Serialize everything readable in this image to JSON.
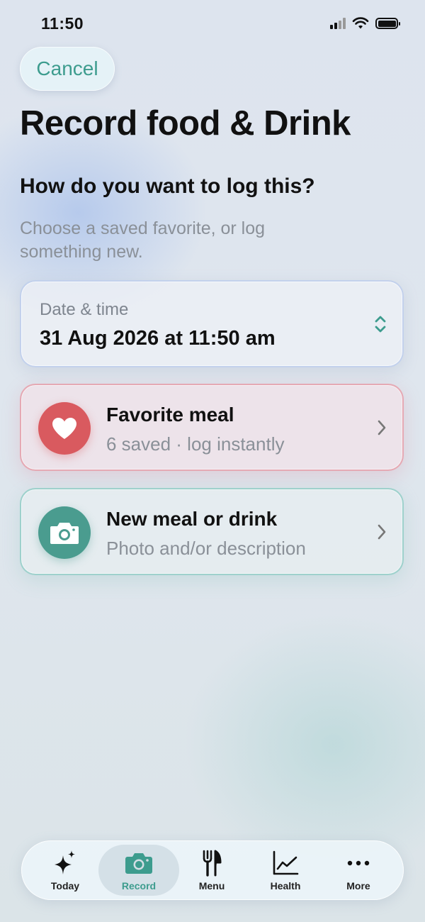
{
  "status_bar": {
    "time": "11:50"
  },
  "header": {
    "cancel_label": "Cancel",
    "title": "Record food & Drink"
  },
  "prompt": {
    "question": "How do you want to log this?",
    "subtitle": "Choose a saved favorite, or log something new."
  },
  "date_time": {
    "label": "Date & time",
    "value": "31 Aug 2026 at 11:50 am"
  },
  "options": [
    {
      "title": "Favorite meal",
      "subtitle": "6 saved · log instantly",
      "icon": "heart-icon",
      "color": "#d95a5f"
    },
    {
      "title": "New meal or drink",
      "subtitle": "Photo and/or description",
      "icon": "camera-icon",
      "color": "#4a9c8f"
    }
  ],
  "tabs": [
    {
      "label": "Today",
      "icon": "sparkle-icon"
    },
    {
      "label": "Record",
      "icon": "camera-icon",
      "active": true
    },
    {
      "label": "Menu",
      "icon": "fork-knife-icon"
    },
    {
      "label": "Health",
      "icon": "chart-line-icon"
    },
    {
      "label": "More",
      "icon": "ellipsis-icon"
    }
  ],
  "colors": {
    "accent": "#3d9c8e",
    "favorite": "#d95a5f"
  }
}
